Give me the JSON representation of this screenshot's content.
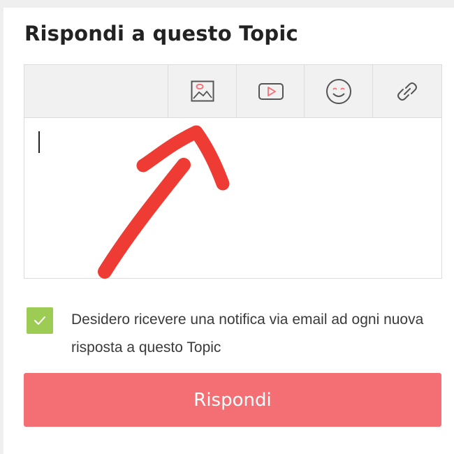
{
  "reply_form": {
    "title": "Rispondi a questo Topic",
    "toolbar": {
      "buttons": [
        {
          "icon": "image-icon"
        },
        {
          "icon": "video-play-icon"
        },
        {
          "icon": "smiley-icon"
        },
        {
          "icon": "link-icon"
        }
      ]
    },
    "editor_value": "",
    "notification": {
      "checked": true,
      "label": "Desidero ricevere una notifica via email ad ogni nuova risposta a questo Topic"
    },
    "submit_label": "Rispondi"
  },
  "colors": {
    "accent_red": "#f46f73",
    "checkbox_green": "#9ccc53",
    "annotation_red": "#ee3b33",
    "toolbar_bg": "#f1f1f1"
  }
}
